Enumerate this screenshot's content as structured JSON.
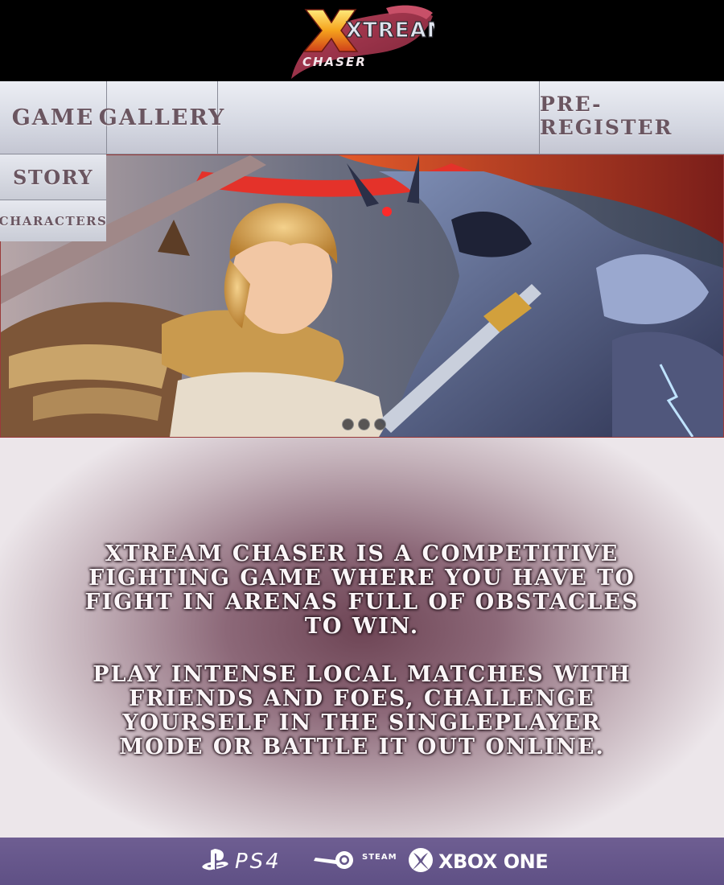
{
  "header": {
    "logo": {
      "icon": "xtream-chaser-logo",
      "text_main": "XTREAM",
      "text_sub": "CHASER"
    }
  },
  "nav": {
    "items": [
      {
        "label": "GAME"
      },
      {
        "label": "GALLERY"
      },
      {
        "label": "PRE-REGISTER"
      }
    ],
    "dropdown": [
      {
        "label": "STORY"
      },
      {
        "label": "CHARACTERS"
      }
    ]
  },
  "hero": {
    "image": "fighters-clash-illustration",
    "slides": 3
  },
  "main": {
    "paragraphs": [
      "XTREAM CHASER IS A COMPETITIVE FIGHTING GAME WHERE YOU HAVE TO FIGHT IN ARENAS FULL OF OBSTACLES TO WIN.",
      "PLAY INTENSE LOCAL MATCHES WITH FRIENDS AND FOES, CHALLENGE YOURSELF IN THE SINGLEPLAYER MODE OR BATTLE IT OUT ONLINE."
    ]
  },
  "footer": {
    "platforms": [
      {
        "icon": "playstation-icon",
        "label": "PS4"
      },
      {
        "icon": "steam-icon",
        "label": "STEAM"
      },
      {
        "icon": "xbox-icon",
        "label": "XBOX ONE"
      }
    ]
  },
  "colors": {
    "nav_text": "#6a5560",
    "footer_bg": "#65568a",
    "main_center": "#6e4555"
  }
}
